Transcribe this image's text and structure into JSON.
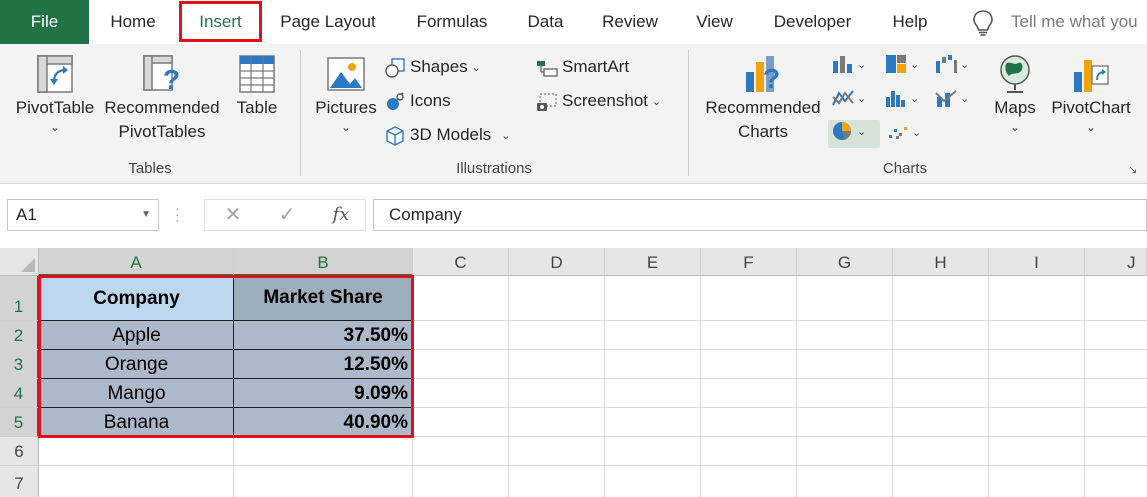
{
  "tabs": [
    "File",
    "Home",
    "Insert",
    "Page Layout",
    "Formulas",
    "Data",
    "Review",
    "View",
    "Developer",
    "Help"
  ],
  "active_tab": "Insert",
  "tell_me": "Tell me what you",
  "ribbon": {
    "tables": {
      "pivottable": "PivotTable",
      "recommended_line1": "Recommended",
      "recommended_line2": "PivotTables",
      "table": "Table",
      "label": "Tables"
    },
    "illustrations": {
      "pictures": "Pictures",
      "shapes": "Shapes",
      "icons": "Icons",
      "models": "3D Models",
      "smartart": "SmartArt",
      "screenshot": "Screenshot",
      "label": "Illustrations"
    },
    "charts": {
      "recommended_line1": "Recommended",
      "recommended_line2": "Charts",
      "maps": "Maps",
      "pivotchart": "PivotChart",
      "label": "Charts"
    }
  },
  "formula_bar": {
    "name_box": "A1",
    "cancel": "✕",
    "enter": "✓",
    "fx": "fx",
    "content": "Company"
  },
  "grid": {
    "columns": [
      "A",
      "B",
      "C",
      "D",
      "E",
      "F",
      "G",
      "H",
      "I",
      "J"
    ],
    "rows": [
      "1",
      "2",
      "3",
      "4",
      "5",
      "6",
      "7"
    ],
    "header": {
      "company": "Company",
      "share": "Market Share"
    },
    "data": [
      {
        "company": "Apple",
        "share": "37.50%"
      },
      {
        "company": "Orange",
        "share": "12.50%"
      },
      {
        "company": "Mango",
        "share": "9.09%"
      },
      {
        "company": "Banana",
        "share": "40.90%"
      }
    ]
  },
  "colors": {
    "excel_green": "#217346",
    "highlight_red": "#e0101c",
    "header_a_fill": "#bdd7ee",
    "header_b_fill": "#9dadbb",
    "data_fill": "#acb9ca"
  }
}
